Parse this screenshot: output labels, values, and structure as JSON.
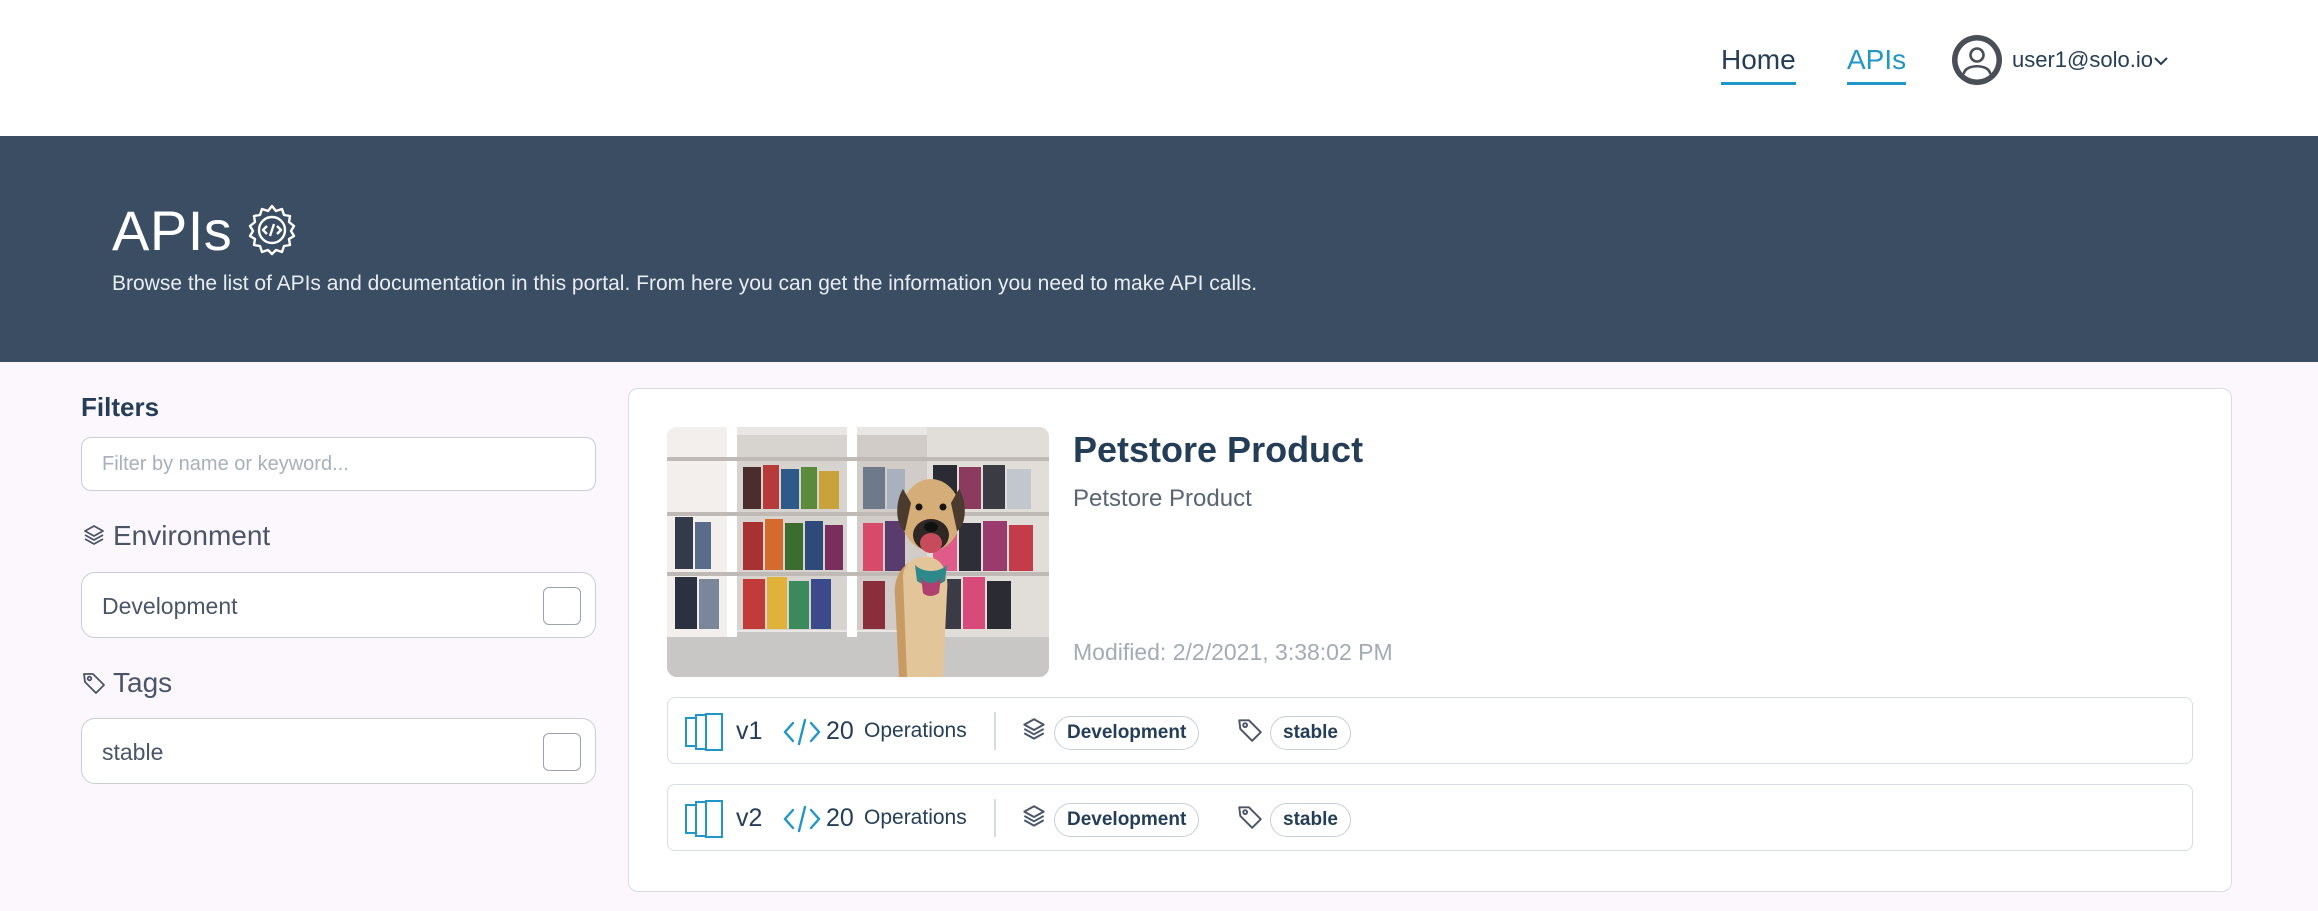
{
  "nav": {
    "home_label": "Home",
    "apis_label": "APIs",
    "user_email": "user1@solo.io",
    "accent_color": "#2196c9"
  },
  "banner": {
    "title": "APIs",
    "subtitle": "Browse the list of APIs and documentation in this portal. From here you can get the information you need to make API calls.",
    "background_color": "#3b4d63"
  },
  "filters": {
    "heading": "Filters",
    "search_placeholder": "Filter by name or keyword...",
    "search_value": "",
    "environment": {
      "heading": "Environment",
      "options": [
        {
          "label": "Development",
          "checked": false
        }
      ]
    },
    "tags": {
      "heading": "Tags",
      "options": [
        {
          "label": "stable",
          "checked": false
        }
      ]
    }
  },
  "api_card": {
    "title": "Petstore Product",
    "description": "Petstore Product",
    "modified": "Modified: 2/2/2021, 3:38:02 PM",
    "versions": [
      {
        "version": "v1",
        "operations_count": "20",
        "operations_label": "Operations",
        "environment": "Development",
        "tag": "stable"
      },
      {
        "version": "v2",
        "operations_count": "20",
        "operations_label": "Operations",
        "environment": "Development",
        "tag": "stable"
      }
    ]
  },
  "icons": {
    "user": "user-circle-icon",
    "chevron": "chevron-down-icon",
    "title_gear": "gear-code-icon",
    "environment": "cube-stack-icon",
    "tag": "tag-icon",
    "version": "version-pages-icon",
    "code": "code-icon"
  }
}
